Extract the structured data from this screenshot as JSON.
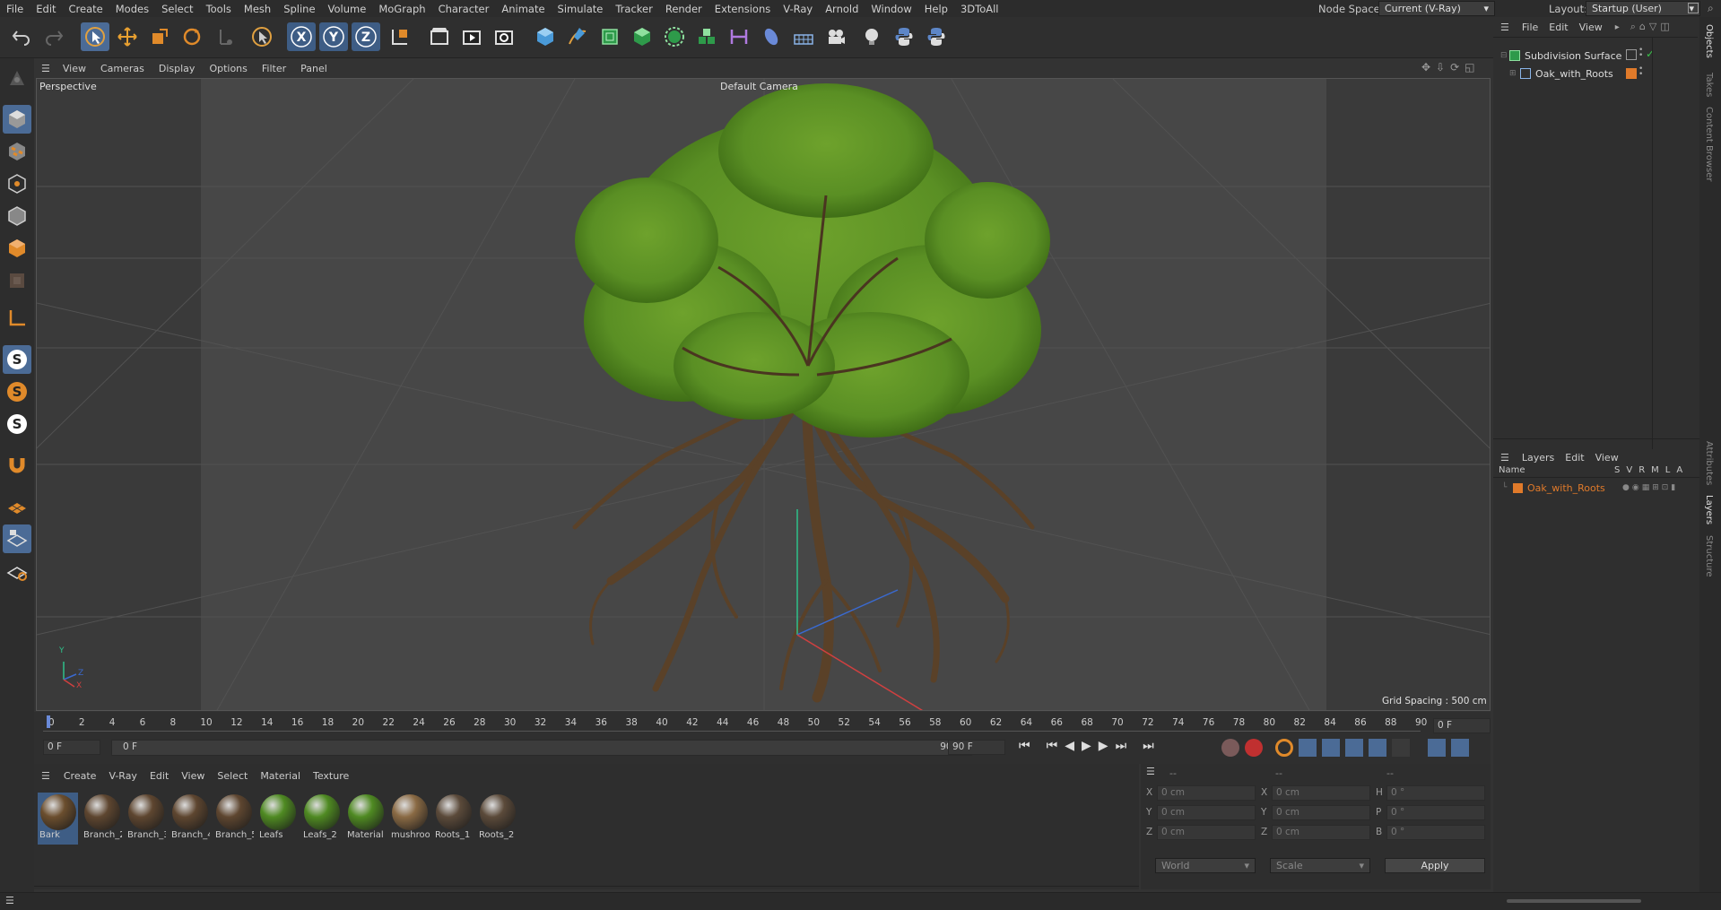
{
  "menu": [
    "File",
    "Edit",
    "Create",
    "Modes",
    "Select",
    "Tools",
    "Mesh",
    "Spline",
    "Volume",
    "MoGraph",
    "Character",
    "Animate",
    "Simulate",
    "Tracker",
    "Render",
    "Extensions",
    "V-Ray",
    "Arnold",
    "Window",
    "Help",
    "3DToAll"
  ],
  "node_space": {
    "label": "Node Space:",
    "value": "Current (V-Ray)"
  },
  "layout": {
    "label": "Layout:",
    "value": "Startup (User)"
  },
  "viewport_menu": [
    "View",
    "Cameras",
    "Display",
    "Options",
    "Filter",
    "Panel"
  ],
  "viewport": {
    "name": "Perspective",
    "camera": "Default Camera",
    "grid_spacing": "Grid Spacing : 500 cm"
  },
  "timeline": {
    "ticks": [
      "0",
      "2",
      "4",
      "6",
      "8",
      "10",
      "12",
      "14",
      "16",
      "18",
      "20",
      "22",
      "24",
      "26",
      "28",
      "30",
      "32",
      "34",
      "36",
      "38",
      "40",
      "42",
      "44",
      "46",
      "48",
      "50",
      "52",
      "54",
      "56",
      "58",
      "60",
      "62",
      "64",
      "66",
      "68",
      "70",
      "72",
      "74",
      "76",
      "78",
      "80",
      "82",
      "84",
      "86",
      "88",
      "90"
    ],
    "current_frame": "0 F",
    "start": "0 F",
    "range_start": "0 F",
    "range_end": "90 F",
    "end": "90 F"
  },
  "material_menu": [
    "Create",
    "V-Ray",
    "Edit",
    "View",
    "Select",
    "Material",
    "Texture"
  ],
  "materials": [
    {
      "name": "Bark",
      "color": "#6b4e2e"
    },
    {
      "name": "Branch_2",
      "color": "#5e4630"
    },
    {
      "name": "Branch_3",
      "color": "#5e4630"
    },
    {
      "name": "Branch_4",
      "color": "#5e4630"
    },
    {
      "name": "Branch_5",
      "color": "#5e4630"
    },
    {
      "name": "Leafs",
      "color": "#4f8a22"
    },
    {
      "name": "Leafs_2",
      "color": "#4f8a22"
    },
    {
      "name": "Material",
      "color": "#4f8a22"
    },
    {
      "name": "mushroo",
      "color": "#8a6a44"
    },
    {
      "name": "Roots_1",
      "color": "#5b4a3a"
    },
    {
      "name": "Roots_2",
      "color": "#5b4a3a"
    }
  ],
  "coords": {
    "header": [
      "--",
      "--",
      "--"
    ],
    "rows": [
      {
        "a": "X",
        "av": "0 cm",
        "b": "X",
        "bv": "0 cm",
        "c": "H",
        "cv": "0 °"
      },
      {
        "a": "Y",
        "av": "0 cm",
        "b": "Y",
        "bv": "0 cm",
        "c": "P",
        "cv": "0 °"
      },
      {
        "a": "Z",
        "av": "0 cm",
        "b": "Z",
        "bv": "0 cm",
        "c": "B",
        "cv": "0 °"
      }
    ],
    "space": "World",
    "mode": "Scale",
    "apply": "Apply"
  },
  "objects_menu": [
    "File",
    "Edit",
    "View"
  ],
  "objects": [
    {
      "name": "Subdivision Surface"
    },
    {
      "name": "Oak_with_Roots"
    }
  ],
  "layers_menu": [
    "Layers",
    "Edit",
    "View"
  ],
  "layers_header": {
    "name": "Name",
    "cols": [
      "S",
      "V",
      "R",
      "M",
      "L",
      "A"
    ]
  },
  "layers": [
    {
      "name": "Oak_with_Roots"
    }
  ],
  "side_tabs": [
    "Objects",
    "Takes",
    "Content Browser",
    "Attributes",
    "Layers",
    "Structure"
  ],
  "colors": {
    "accent": "#4b6b96",
    "orange": "#e07a2a",
    "leaf": "#5a8f24",
    "bark": "#5a4128"
  }
}
